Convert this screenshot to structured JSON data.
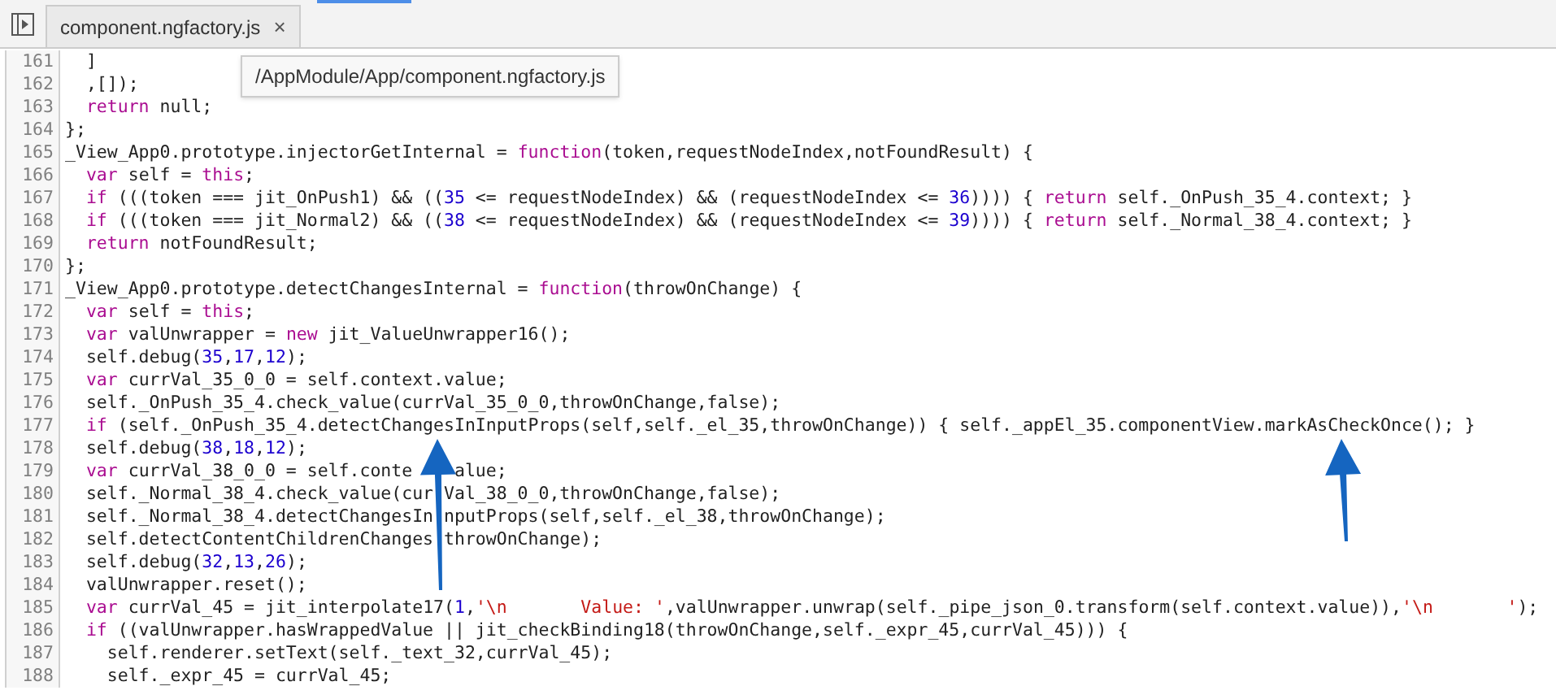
{
  "tabs": [
    {
      "label": "component.ngfactory.js",
      "close": "×",
      "selected": true
    }
  ],
  "tooltip": "/AppModule/App/component.ngfactory.js",
  "code": [
    {
      "number": "161",
      "tokens": [
        {
          "kind": "plain",
          "text": "  ]"
        }
      ]
    },
    {
      "number": "162",
      "tokens": [
        {
          "kind": "plain",
          "text": "  ,[]);"
        }
      ]
    },
    {
      "number": "163",
      "tokens": [
        {
          "kind": "keyword",
          "text": "  return"
        },
        {
          "kind": "plain",
          "text": " null;"
        }
      ]
    },
    {
      "number": "164",
      "tokens": [
        {
          "kind": "plain",
          "text": "};"
        }
      ]
    },
    {
      "number": "165",
      "tokens": [
        {
          "kind": "plain",
          "text": "_View_App0.prototype.injectorGetInternal = "
        },
        {
          "kind": "keyword",
          "text": "function"
        },
        {
          "kind": "plain",
          "text": "(token,requestNodeIndex,notFoundResult) {"
        }
      ]
    },
    {
      "number": "166",
      "tokens": [
        {
          "kind": "keyword",
          "text": "  var"
        },
        {
          "kind": "plain",
          "text": " self = "
        },
        {
          "kind": "keyword",
          "text": "this"
        },
        {
          "kind": "plain",
          "text": ";"
        }
      ]
    },
    {
      "number": "167",
      "tokens": [
        {
          "kind": "keyword",
          "text": "  if"
        },
        {
          "kind": "plain",
          "text": " (((token === jit_OnPush1) && (("
        },
        {
          "kind": "number",
          "text": "35"
        },
        {
          "kind": "plain",
          "text": " <= requestNodeIndex) && (requestNodeIndex <= "
        },
        {
          "kind": "number",
          "text": "36"
        },
        {
          "kind": "plain",
          "text": ")))) { "
        },
        {
          "kind": "keyword",
          "text": "return"
        },
        {
          "kind": "plain",
          "text": " self._OnPush_35_4.context; }"
        }
      ]
    },
    {
      "number": "168",
      "tokens": [
        {
          "kind": "keyword",
          "text": "  if"
        },
        {
          "kind": "plain",
          "text": " (((token === jit_Normal2) && (("
        },
        {
          "kind": "number",
          "text": "38"
        },
        {
          "kind": "plain",
          "text": " <= requestNodeIndex) && (requestNodeIndex <= "
        },
        {
          "kind": "number",
          "text": "39"
        },
        {
          "kind": "plain",
          "text": ")))) { "
        },
        {
          "kind": "keyword",
          "text": "return"
        },
        {
          "kind": "plain",
          "text": " self._Normal_38_4.context; }"
        }
      ]
    },
    {
      "number": "169",
      "tokens": [
        {
          "kind": "keyword",
          "text": "  return"
        },
        {
          "kind": "plain",
          "text": " notFoundResult;"
        }
      ]
    },
    {
      "number": "170",
      "tokens": [
        {
          "kind": "plain",
          "text": "};"
        }
      ]
    },
    {
      "number": "171",
      "tokens": [
        {
          "kind": "plain",
          "text": "_View_App0.prototype.detectChangesInternal = "
        },
        {
          "kind": "keyword",
          "text": "function"
        },
        {
          "kind": "plain",
          "text": "(throwOnChange) {"
        }
      ]
    },
    {
      "number": "172",
      "tokens": [
        {
          "kind": "keyword",
          "text": "  var"
        },
        {
          "kind": "plain",
          "text": " self = "
        },
        {
          "kind": "keyword",
          "text": "this"
        },
        {
          "kind": "plain",
          "text": ";"
        }
      ]
    },
    {
      "number": "173",
      "tokens": [
        {
          "kind": "keyword",
          "text": "  var"
        },
        {
          "kind": "plain",
          "text": " valUnwrapper = "
        },
        {
          "kind": "keyword",
          "text": "new"
        },
        {
          "kind": "plain",
          "text": " jit_ValueUnwrapper16();"
        }
      ]
    },
    {
      "number": "174",
      "tokens": [
        {
          "kind": "plain",
          "text": "  self.debug("
        },
        {
          "kind": "number",
          "text": "35"
        },
        {
          "kind": "plain",
          "text": ","
        },
        {
          "kind": "number",
          "text": "17"
        },
        {
          "kind": "plain",
          "text": ","
        },
        {
          "kind": "number",
          "text": "12"
        },
        {
          "kind": "plain",
          "text": ");"
        }
      ]
    },
    {
      "number": "175",
      "tokens": [
        {
          "kind": "keyword",
          "text": "  var"
        },
        {
          "kind": "plain",
          "text": " currVal_35_0_0 = self.context.value;"
        }
      ]
    },
    {
      "number": "176",
      "tokens": [
        {
          "kind": "plain",
          "text": "  self._OnPush_35_4.check_value(currVal_35_0_0,throwOnChange,false);"
        }
      ]
    },
    {
      "number": "177",
      "tokens": [
        {
          "kind": "keyword",
          "text": "  if"
        },
        {
          "kind": "plain",
          "text": " (self._OnPush_35_4.detectChangesInInputProps(self,self._el_35,throwOnChange)) { self._appEl_35.componentView.markAsCheckOnce(); }"
        }
      ]
    },
    {
      "number": "178",
      "tokens": [
        {
          "kind": "plain",
          "text": "  self.debug("
        },
        {
          "kind": "number",
          "text": "38"
        },
        {
          "kind": "plain",
          "text": ","
        },
        {
          "kind": "number",
          "text": "18"
        },
        {
          "kind": "plain",
          "text": ","
        },
        {
          "kind": "number",
          "text": "12"
        },
        {
          "kind": "plain",
          "text": ");"
        }
      ]
    },
    {
      "number": "179",
      "tokens": [
        {
          "kind": "keyword",
          "text": "  var"
        },
        {
          "kind": "plain",
          "text": " currVal_38_0_0 = self.conte    alue;"
        }
      ]
    },
    {
      "number": "180",
      "tokens": [
        {
          "kind": "plain",
          "text": "  self._Normal_38_4.check_value(cur Val_38_0_0,throwOnChange,false);"
        }
      ]
    },
    {
      "number": "181",
      "tokens": [
        {
          "kind": "plain",
          "text": "  self._Normal_38_4.detectChangesIn nputProps(self,self._el_38,throwOnChange);"
        }
      ]
    },
    {
      "number": "182",
      "tokens": [
        {
          "kind": "plain",
          "text": "  self.detectContentChildrenChanges throwOnChange);"
        }
      ]
    },
    {
      "number": "183",
      "tokens": [
        {
          "kind": "plain",
          "text": "  self.debug("
        },
        {
          "kind": "number",
          "text": "32"
        },
        {
          "kind": "plain",
          "text": ","
        },
        {
          "kind": "number",
          "text": "13"
        },
        {
          "kind": "plain",
          "text": ","
        },
        {
          "kind": "number",
          "text": "26"
        },
        {
          "kind": "plain",
          "text": ");"
        }
      ]
    },
    {
      "number": "184",
      "tokens": [
        {
          "kind": "plain",
          "text": "  valUnwrapper.reset();"
        }
      ]
    },
    {
      "number": "185",
      "tokens": [
        {
          "kind": "keyword",
          "text": "  var"
        },
        {
          "kind": "plain",
          "text": " currVal_45 = jit_interpolate17("
        },
        {
          "kind": "number",
          "text": "1"
        },
        {
          "kind": "plain",
          "text": ","
        },
        {
          "kind": "string",
          "text": "'\\n       Value: '"
        },
        {
          "kind": "plain",
          "text": ",valUnwrapper.unwrap(self._pipe_json_0.transform(self.context.value)),"
        },
        {
          "kind": "string",
          "text": "'\\n       '"
        },
        {
          "kind": "plain",
          "text": ");"
        }
      ]
    },
    {
      "number": "186",
      "tokens": [
        {
          "kind": "keyword",
          "text": "  if"
        },
        {
          "kind": "plain",
          "text": " ((valUnwrapper.hasWrappedValue || jit_checkBinding18(throwOnChange,self._expr_45,currVal_45))) {"
        }
      ]
    },
    {
      "number": "187",
      "tokens": [
        {
          "kind": "plain",
          "text": "    self.renderer.setText(self._text_32,currVal_45);"
        }
      ]
    },
    {
      "number": "188",
      "tokens": [
        {
          "kind": "plain",
          "text": "    self._expr_45 = currVal_45;"
        }
      ]
    }
  ]
}
